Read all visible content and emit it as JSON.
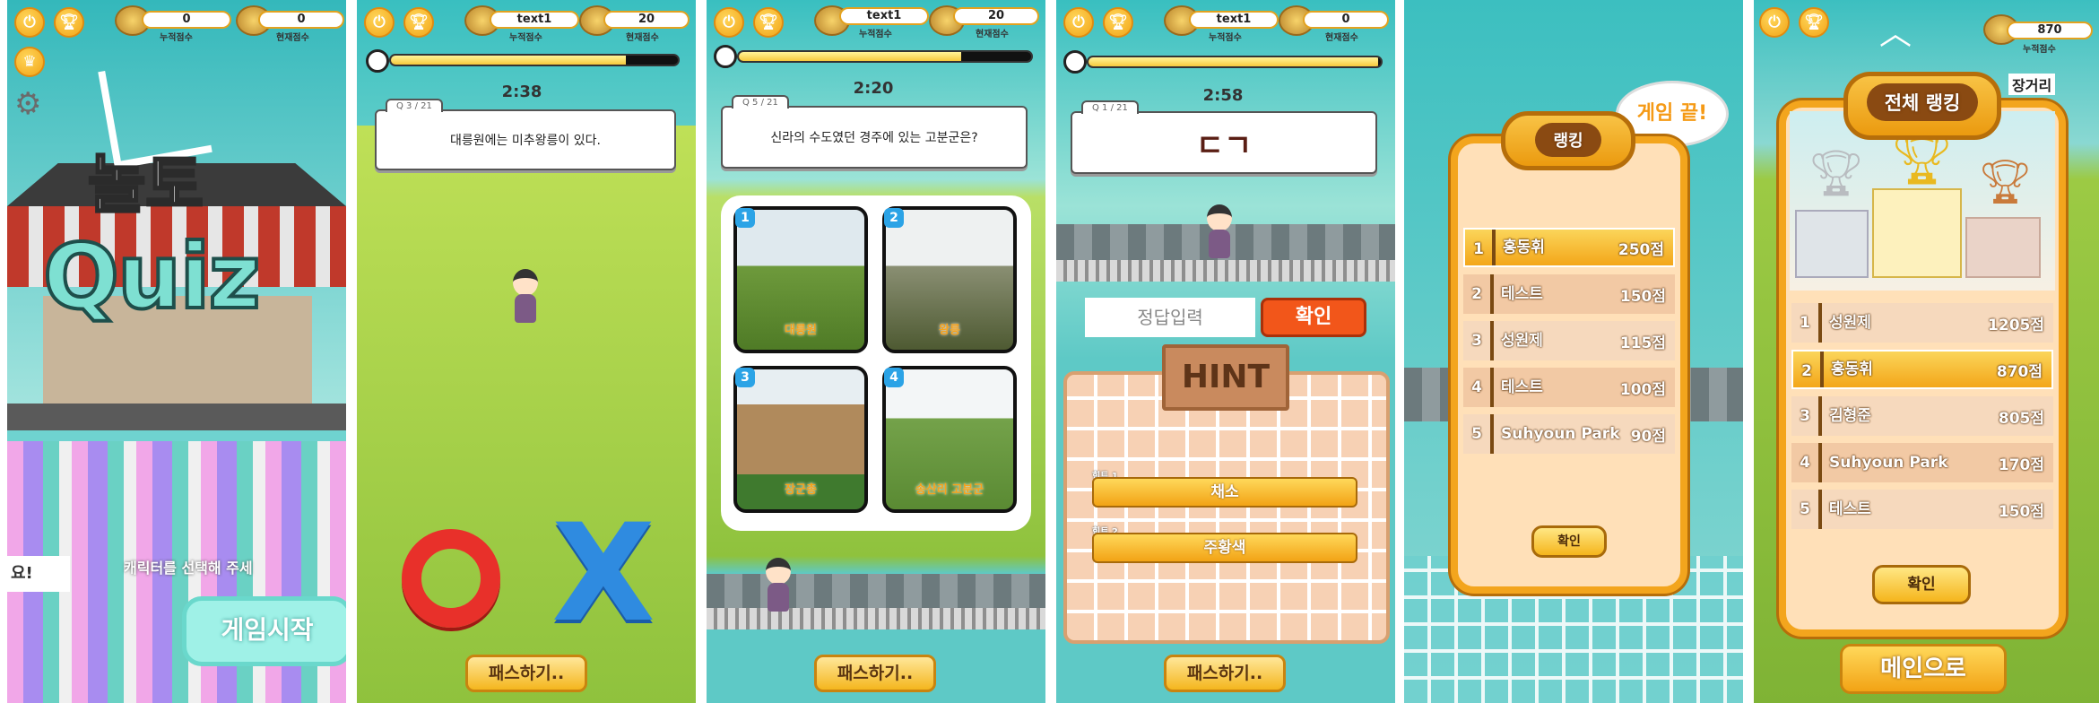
{
  "screen1": {
    "score_total": "0",
    "score_current": "0",
    "score_total_label": "누적점수",
    "score_current_label": "현재점수",
    "logo_top": "놀토",
    "logo_bottom": "Quiz",
    "select_text": "캐릭터를 선택해 주세",
    "left_label": "요!",
    "start_button": "게임시작"
  },
  "screen2": {
    "name": "text1",
    "score": "20",
    "score_total_label": "누적점수",
    "score_current_label": "현재점수",
    "timer": "2:38",
    "timer_fraction": 0.82,
    "question_no": "Q 3 / 21",
    "question": "대릉원에는 미추왕릉이 있다.",
    "answer_o": "O",
    "answer_x": "X",
    "pass_button": "패스하기.."
  },
  "screen3": {
    "name": "text1",
    "score": "20",
    "score_total_label": "누적점수",
    "score_current_label": "현재점수",
    "timer": "2:20",
    "timer_fraction": 0.76,
    "question_no": "Q 5 / 21",
    "question": "신라의 수도였던 경주에 있는 고분군은?",
    "choices": [
      {
        "num": "1",
        "label": "대릉원"
      },
      {
        "num": "2",
        "label": "왕릉"
      },
      {
        "num": "3",
        "label": "장군총"
      },
      {
        "num": "4",
        "label": "송산리 고분군"
      }
    ],
    "pass_button": "패스하기.."
  },
  "screen4": {
    "name": "text1",
    "score": "0",
    "score_total_label": "누적점수",
    "score_current_label": "현재점수",
    "timer": "2:58",
    "timer_fraction": 0.99,
    "question_no": "Q 1 / 21",
    "question": "ㄷㄱ",
    "answer_placeholder": "정답입력",
    "confirm_button": "확인",
    "hint_title": "HINT",
    "hints": [
      {
        "tag": "힌트 1",
        "text": "채소"
      },
      {
        "tag": "힌트 2",
        "text": "주황색"
      }
    ],
    "pass_button": "패스하기.."
  },
  "screen5": {
    "game_over": "게임 끝!",
    "title": "랭킹",
    "rows": [
      {
        "rank": "1",
        "name": "홍동휘",
        "points": "250점"
      },
      {
        "rank": "2",
        "name": "테스트",
        "points": "150점"
      },
      {
        "rank": "3",
        "name": "성원제",
        "points": "115점"
      },
      {
        "rank": "4",
        "name": "테스트",
        "points": "100점"
      },
      {
        "rank": "5",
        "name": "Suhyoun Park",
        "points": "90점"
      }
    ],
    "ok_button": "확인"
  },
  "screen6": {
    "score": "870",
    "score_total_label": "누적점수",
    "side_label": "장거리",
    "title": "전체 랭킹",
    "rows": [
      {
        "rank": "1",
        "name": "성원제",
        "points": "1205점"
      },
      {
        "rank": "2",
        "name": "홍동휘",
        "points": "870점"
      },
      {
        "rank": "3",
        "name": "김형준",
        "points": "805점"
      },
      {
        "rank": "4",
        "name": "Suhyoun Park",
        "points": "170점"
      },
      {
        "rank": "5",
        "name": "테스트",
        "points": "150점"
      }
    ],
    "ok_button": "확인",
    "main_button": "메인으로"
  },
  "colors": {
    "accent": "#f3a51d",
    "sky": "#39bfc0",
    "grass": "#9cca44",
    "o_red": "#e8302a",
    "x_blue": "#2f8be0",
    "confirm": "#f2561a"
  }
}
